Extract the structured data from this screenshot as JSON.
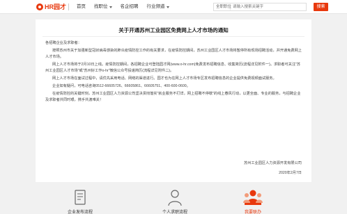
{
  "header": {
    "logo_text": "HR园才",
    "nav": [
      {
        "label": "首页"
      },
      {
        "label": "找职位"
      },
      {
        "label": "名企招聘"
      },
      {
        "label": "行业频道"
      }
    ],
    "search": {
      "select_value": "全职职位",
      "placeholder": "请输入搜索关键字",
      "button_label": "搜索"
    },
    "accent_color": "#e8380d"
  },
  "article": {
    "title": "关于开通苏州工业园区免费网上人才市场的通知",
    "greeting": "各招聘企业及求职者：",
    "paragraphs": [
      "按照苏州市关于加强新型冠状病毒感染的肺炎疫情防控工作的有关要求，在疫情防控期间，苏州工业园区人才市场将暂停所有现场招聘活动，并开通免费网上人才市场。",
      "网上人才市场将于2月10日上线。疫情防控期间，各招聘企业可登陆园才网(www.o-hr.com)免费发布招聘信息、收集简历(流程详见附件一)。求职者可关注\"苏州工业园区人才市场\"或\"苏州好工作o-hr\"微信公众号投递简历(流程详见附件二)。",
      "网上人才市场在面试过程中，请优先采用电话、网络的渠道进行。园才也为在网上人才市场专区发布招聘信息的企业提供免费视频面试服务。",
      "企业如有疑问，可电话咨询0512-66605726、66605861、66605751、400-600-0600。",
      "在疫情防控的关键时刻，苏州工业园区人力资源公司坚决贯彻落实\"就业服务不打烊，网上招聘不停歇\"的线上春风行动，以更全面、专业的服务，与招聘企业及求职者共同时艰，携手共渡难关！"
    ],
    "sign_org": "苏州工业园区人力资源开发有限公司",
    "sign_date": "2020年2月7日"
  },
  "footer": {
    "cards": [
      {
        "label": "企业发布流程",
        "icon": "document-icon"
      },
      {
        "label": "个人求职流程",
        "icon": "person-icon"
      },
      {
        "label": "我要联办",
        "icon": "team-icon"
      }
    ]
  }
}
